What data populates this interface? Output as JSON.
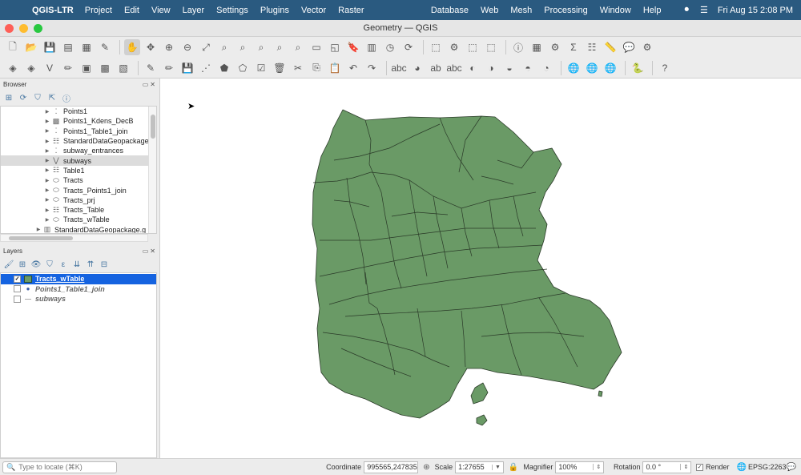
{
  "menubar": {
    "app_name": "QGIS-LTR",
    "items": [
      "Project",
      "Edit",
      "View",
      "Layer",
      "Settings",
      "Plugins",
      "Vector",
      "Raster",
      "Database",
      "Web",
      "Mesh",
      "Processing",
      "Window",
      "Help"
    ],
    "clock": "Fri Aug 15  2:08 PM"
  },
  "window": {
    "title": "Geometry — QGIS"
  },
  "browser": {
    "title": "Browser",
    "items": [
      {
        "label": "Points1",
        "icon": "point-layer-icon",
        "indent": 1
      },
      {
        "label": "Points1_Kdens_DecB",
        "icon": "raster-layer-icon",
        "indent": 1
      },
      {
        "label": "Points1_Table1_join",
        "icon": "point-layer-icon",
        "indent": 1
      },
      {
        "label": "StandardDataGeopackage",
        "icon": "table-icon",
        "indent": 1
      },
      {
        "label": "subway_entrances",
        "icon": "point-layer-icon",
        "indent": 1
      },
      {
        "label": "subways",
        "icon": "line-layer-icon",
        "indent": 1,
        "selected": true
      },
      {
        "label": "Table1",
        "icon": "table-icon",
        "indent": 1
      },
      {
        "label": "Tracts",
        "icon": "polygon-layer-icon",
        "indent": 1
      },
      {
        "label": "Tracts_Points1_join",
        "icon": "polygon-layer-icon",
        "indent": 1
      },
      {
        "label": "Tracts_prj",
        "icon": "polygon-layer-icon",
        "indent": 1
      },
      {
        "label": "Tracts_Table",
        "icon": "table-icon",
        "indent": 1
      },
      {
        "label": "Tracts_wTable",
        "icon": "polygon-layer-icon",
        "indent": 1
      },
      {
        "label": "StandardDataGeopackage.g",
        "icon": "geopackage-icon",
        "indent": 0
      }
    ]
  },
  "layers": {
    "title": "Layers",
    "items": [
      {
        "label": "Tracts_wTable",
        "checked": true,
        "symbol": "polygon",
        "selected": true
      },
      {
        "label": "Points1_Table1_join",
        "checked": false,
        "symbol": "point",
        "selected": false
      },
      {
        "label": "subways",
        "checked": false,
        "symbol": "line",
        "selected": false
      }
    ]
  },
  "map": {
    "fill_color": "#6a9a66",
    "stroke_color": "#2a3a28"
  },
  "statusbar": {
    "locator_placeholder": "Type to locate (⌘K)",
    "coordinate_label": "Coordinate",
    "coordinate_value": "995565,247835",
    "scale_label": "Scale",
    "scale_value": "1:27655",
    "magnifier_label": "Magnifier",
    "magnifier_value": "100%",
    "rotation_label": "Rotation",
    "rotation_value": "0.0 °",
    "render_label": "Render",
    "crs": "EPSG:2263"
  }
}
